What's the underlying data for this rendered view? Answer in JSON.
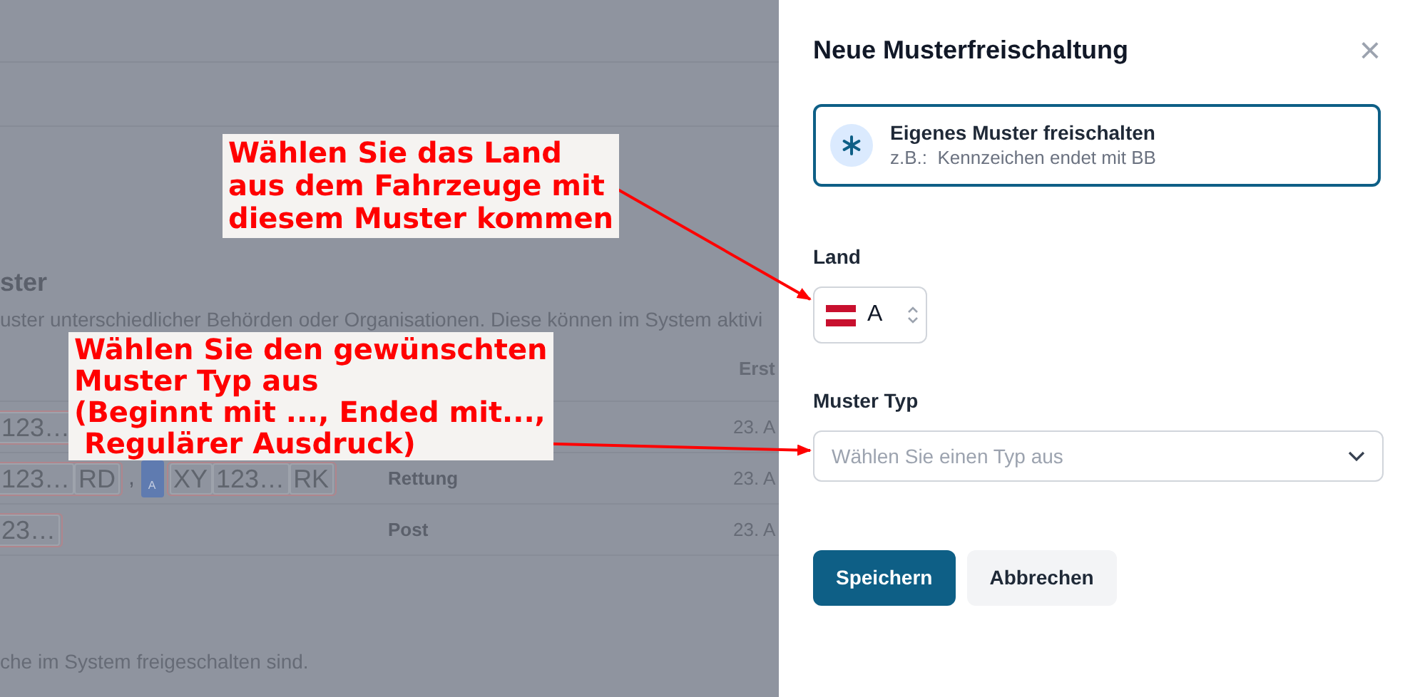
{
  "background": {
    "heading": "ster",
    "description": "uster unterschiedlicher Behörden oder Organisationen. Diese können im System aktivi",
    "columns": [
      {
        "label": "Erst"
      }
    ],
    "rows": [
      {
        "plates": [
          {
            "kind": "plate",
            "parts": [
              "123…"
            ]
          }
        ],
        "date": "23. A"
      },
      {
        "plates": [
          {
            "kind": "plate",
            "parts": [
              "123…",
              "RD"
            ]
          },
          {
            "kind": "sep",
            "text": ","
          },
          {
            "kind": "plate",
            "badge": "A",
            "parts": [
              "XY",
              "123…",
              "RK"
            ]
          }
        ],
        "category": "Rettung",
        "date": "23. A"
      },
      {
        "plates": [
          {
            "kind": "plate",
            "parts": [
              "23…"
            ]
          }
        ],
        "category": "Post",
        "date": "23. A"
      }
    ],
    "footer": "che im System freigeschalten sind."
  },
  "panel": {
    "title": "Neue Musterfreischaltung",
    "close": "×",
    "option": {
      "title": "Eigenes Muster freischalten",
      "subtitle": "z.B.:  Kennzeichen endet mit BB",
      "selected": true
    },
    "land": {
      "label": "Land",
      "value": "A"
    },
    "type": {
      "label": "Muster Typ",
      "placeholder": "Wählen Sie einen Typ aus"
    },
    "buttons": [
      {
        "label": "Speichern",
        "kind": "primary"
      },
      {
        "label": "Abbrechen",
        "kind": "secondary"
      }
    ]
  },
  "annotations": [
    {
      "text": "Wählen Sie das Land\naus dem Fahrzeuge mit\ndiesem Muster kommen"
    },
    {
      "text": "Wählen Sie den gewünschten\nMuster Typ aus\n(Beginnt mit ..., Ended mit...,\n Regulärer Ausdruck)"
    }
  ]
}
